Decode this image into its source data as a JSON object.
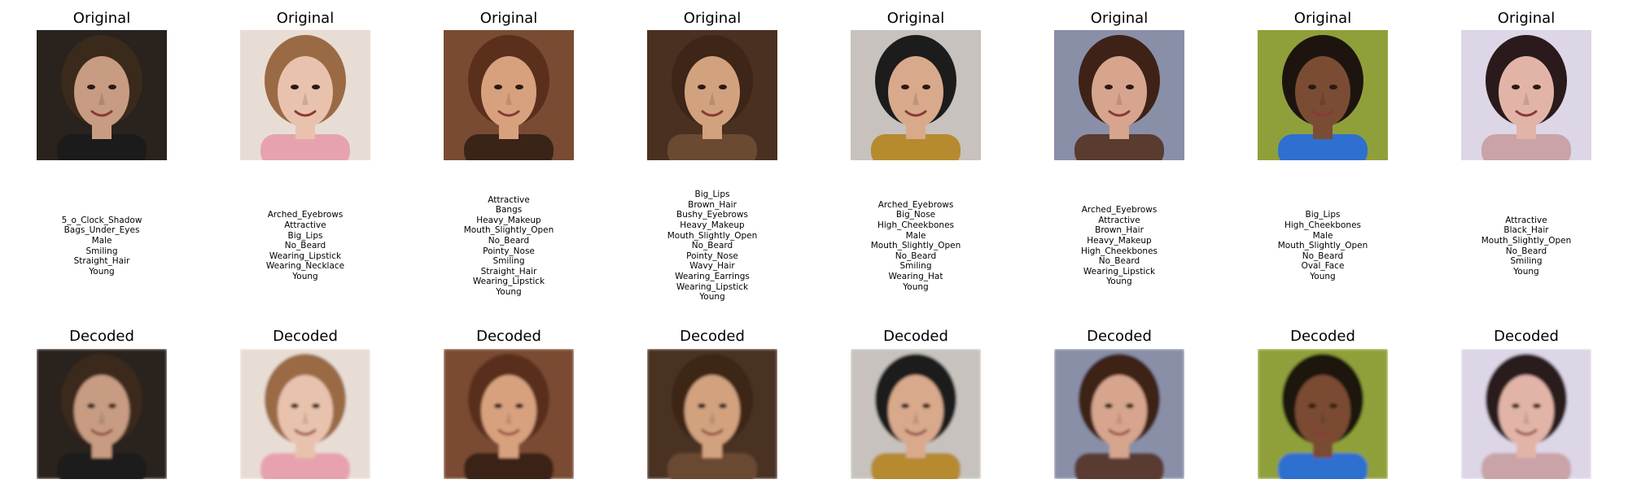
{
  "titles": {
    "original": "Original",
    "decoded": "Decoded"
  },
  "samples": [
    {
      "attributes": [
        "5_o_Clock_Shadow",
        "Bags_Under_Eyes",
        "Male",
        "Smiling",
        "Straight_Hair",
        "Young"
      ],
      "palette": {
        "bg": "#2a221c",
        "skin": "#c89b83",
        "hair": "#3a2a1c",
        "cloth": "#1b1b1b"
      }
    },
    {
      "attributes": [
        "Arched_Eyebrows",
        "Attractive",
        "Big_Lips",
        "No_Beard",
        "Wearing_Lipstick",
        "Wearing_Necklace",
        "Young"
      ],
      "palette": {
        "bg": "#e8ddd5",
        "skin": "#e9c2ad",
        "hair": "#9a6a45",
        "cloth": "#e7a3ad"
      }
    },
    {
      "attributes": [
        "Attractive",
        "Bangs",
        "Heavy_Makeup",
        "Mouth_Slightly_Open",
        "No_Beard",
        "Pointy_Nose",
        "Smiling",
        "Straight_Hair",
        "Wearing_Lipstick",
        "Young"
      ],
      "palette": {
        "bg": "#7a4b33",
        "skin": "#d8a17e",
        "hair": "#5a2f1c",
        "cloth": "#3a2418"
      }
    },
    {
      "attributes": [
        "Big_Lips",
        "Brown_Hair",
        "Bushy_Eyebrows",
        "Heavy_Makeup",
        "Mouth_Slightly_Open",
        "No_Beard",
        "Pointy_Nose",
        "Wavy_Hair",
        "Wearing_Earrings",
        "Wearing_Lipstick",
        "Young"
      ],
      "palette": {
        "bg": "#4a3020",
        "skin": "#d2a27f",
        "hair": "#3d2517",
        "cloth": "#6b4a32"
      }
    },
    {
      "attributes": [
        "Arched_Eyebrows",
        "Big_Nose",
        "High_Cheekbones",
        "Male",
        "Mouth_Slightly_Open",
        "No_Beard",
        "Smiling",
        "Wearing_Hat",
        "Young"
      ],
      "palette": {
        "bg": "#c7c2bd",
        "skin": "#d9a98c",
        "hair": "#1c1c1c",
        "cloth": "#b68a2e"
      }
    },
    {
      "attributes": [
        "Arched_Eyebrows",
        "Attractive",
        "Brown_Hair",
        "Heavy_Makeup",
        "High_Cheekbones",
        "No_Beard",
        "Wearing_Lipstick",
        "Young"
      ],
      "palette": {
        "bg": "#8a8fa8",
        "skin": "#d7a58d",
        "hair": "#3e2218",
        "cloth": "#5a3b30"
      }
    },
    {
      "attributes": [
        "Big_Lips",
        "High_Cheekbones",
        "Male",
        "Mouth_Slightly_Open",
        "No_Beard",
        "Oval_Face",
        "Young"
      ],
      "palette": {
        "bg": "#8fa03a",
        "skin": "#7a4c33",
        "hair": "#1d1410",
        "cloth": "#2f6fd0"
      }
    },
    {
      "attributes": [
        "Attractive",
        "Black_Hair",
        "Mouth_Slightly_Open",
        "No_Beard",
        "Smiling",
        "Young"
      ],
      "palette": {
        "bg": "#dcd6e6",
        "skin": "#e2b4a8",
        "hair": "#2a1a1c",
        "cloth": "#c9a3a8"
      }
    }
  ]
}
